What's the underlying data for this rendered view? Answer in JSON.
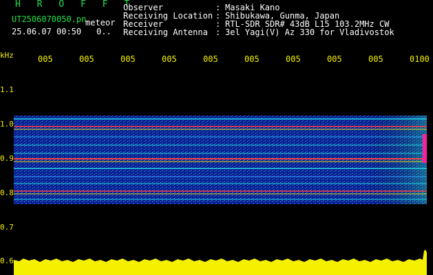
{
  "header": {
    "title": "H R O F F T",
    "file_id": "UT2506070050.pn",
    "meteor_label": "meteor",
    "datetime": "25.06.07 00:50",
    "count": "0.."
  },
  "metadata": [
    {
      "key": "Observer",
      "value": "Masaki Kano"
    },
    {
      "key": "Receiving Location",
      "value": "Shibukawa, Gunma, Japan"
    },
    {
      "key": "Receiver",
      "value": "RTL-SDR SDR# 43dB L15 103.2MHz CW"
    },
    {
      "key": "Receiving Antenna",
      "value": "3el Yagi(V) Az 330 for Vladivostok"
    }
  ],
  "separator": ":",
  "y_axis": {
    "unit": "kHz",
    "ticks": [
      "1.1",
      "1.0",
      "0.9",
      "0.8",
      "0.7",
      "0.6"
    ]
  },
  "x_axis": {
    "ticks": [
      "005",
      "005",
      "005",
      "005",
      "005",
      "005",
      "005",
      "005",
      "005",
      "0100"
    ]
  },
  "colors": {
    "header_green": "#22e04a",
    "axis_yellow": "#f4f000",
    "text_white": "#ffffff",
    "background": "#000000"
  }
}
